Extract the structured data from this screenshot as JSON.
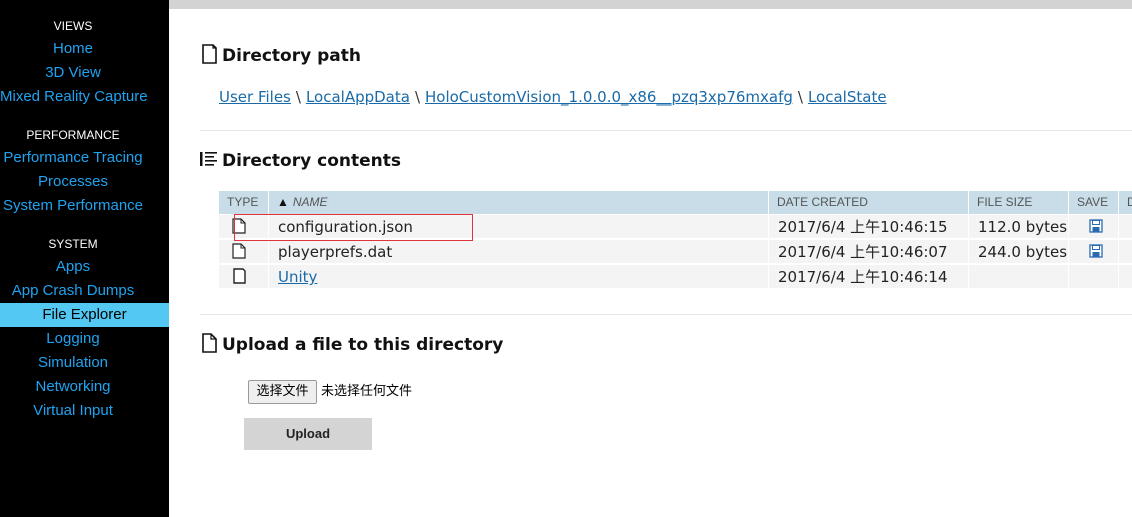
{
  "sidebar": {
    "sections": [
      {
        "heading": "VIEWS",
        "items": [
          "Home",
          "3D View",
          "Mixed Reality Capture"
        ]
      },
      {
        "heading": "PERFORMANCE",
        "items": [
          "Performance Tracing",
          "Processes",
          "System Performance"
        ]
      },
      {
        "heading": "SYSTEM",
        "items": [
          "Apps",
          "App Crash Dumps",
          "File Explorer",
          "Logging",
          "Simulation",
          "Networking",
          "Virtual Input"
        ]
      }
    ],
    "active_item": "File Explorer"
  },
  "directory_path": {
    "title": "Directory path",
    "crumbs": [
      "User Files",
      "LocalAppData",
      "HoloCustomVision_1.0.0.0_x86__pzq3xp76mxafg",
      "LocalState"
    ],
    "separator": "\\"
  },
  "directory_contents": {
    "title": "Directory contents",
    "columns": [
      "TYPE",
      "NAME",
      "DATE CREATED",
      "FILE SIZE",
      "SAVE",
      "D"
    ],
    "sort_indicator": "▲",
    "rows": [
      {
        "type": "file",
        "name": "configuration.json",
        "date": "2017/6/4 上午10:46:15",
        "size": "112.0 bytes",
        "save": true,
        "link": false
      },
      {
        "type": "file",
        "name": "playerprefs.dat",
        "date": "2017/6/4 上午10:46:07",
        "size": "244.0 bytes",
        "save": true,
        "link": false
      },
      {
        "type": "folder",
        "name": "Unity",
        "date": "2017/6/4 上午10:46:14",
        "size": "",
        "save": false,
        "link": true
      }
    ]
  },
  "upload": {
    "title": "Upload a file to this directory",
    "choose_label": "选择文件",
    "choose_status": "未选择任何文件",
    "upload_label": "Upload"
  },
  "colors": {
    "sidebar_bg": "#000000",
    "sidebar_link": "#1fa3f0",
    "sidebar_active": "#52c8f2",
    "table_header": "#c8dde8",
    "highlight": "#e0333b",
    "link": "#1a6aa8"
  }
}
